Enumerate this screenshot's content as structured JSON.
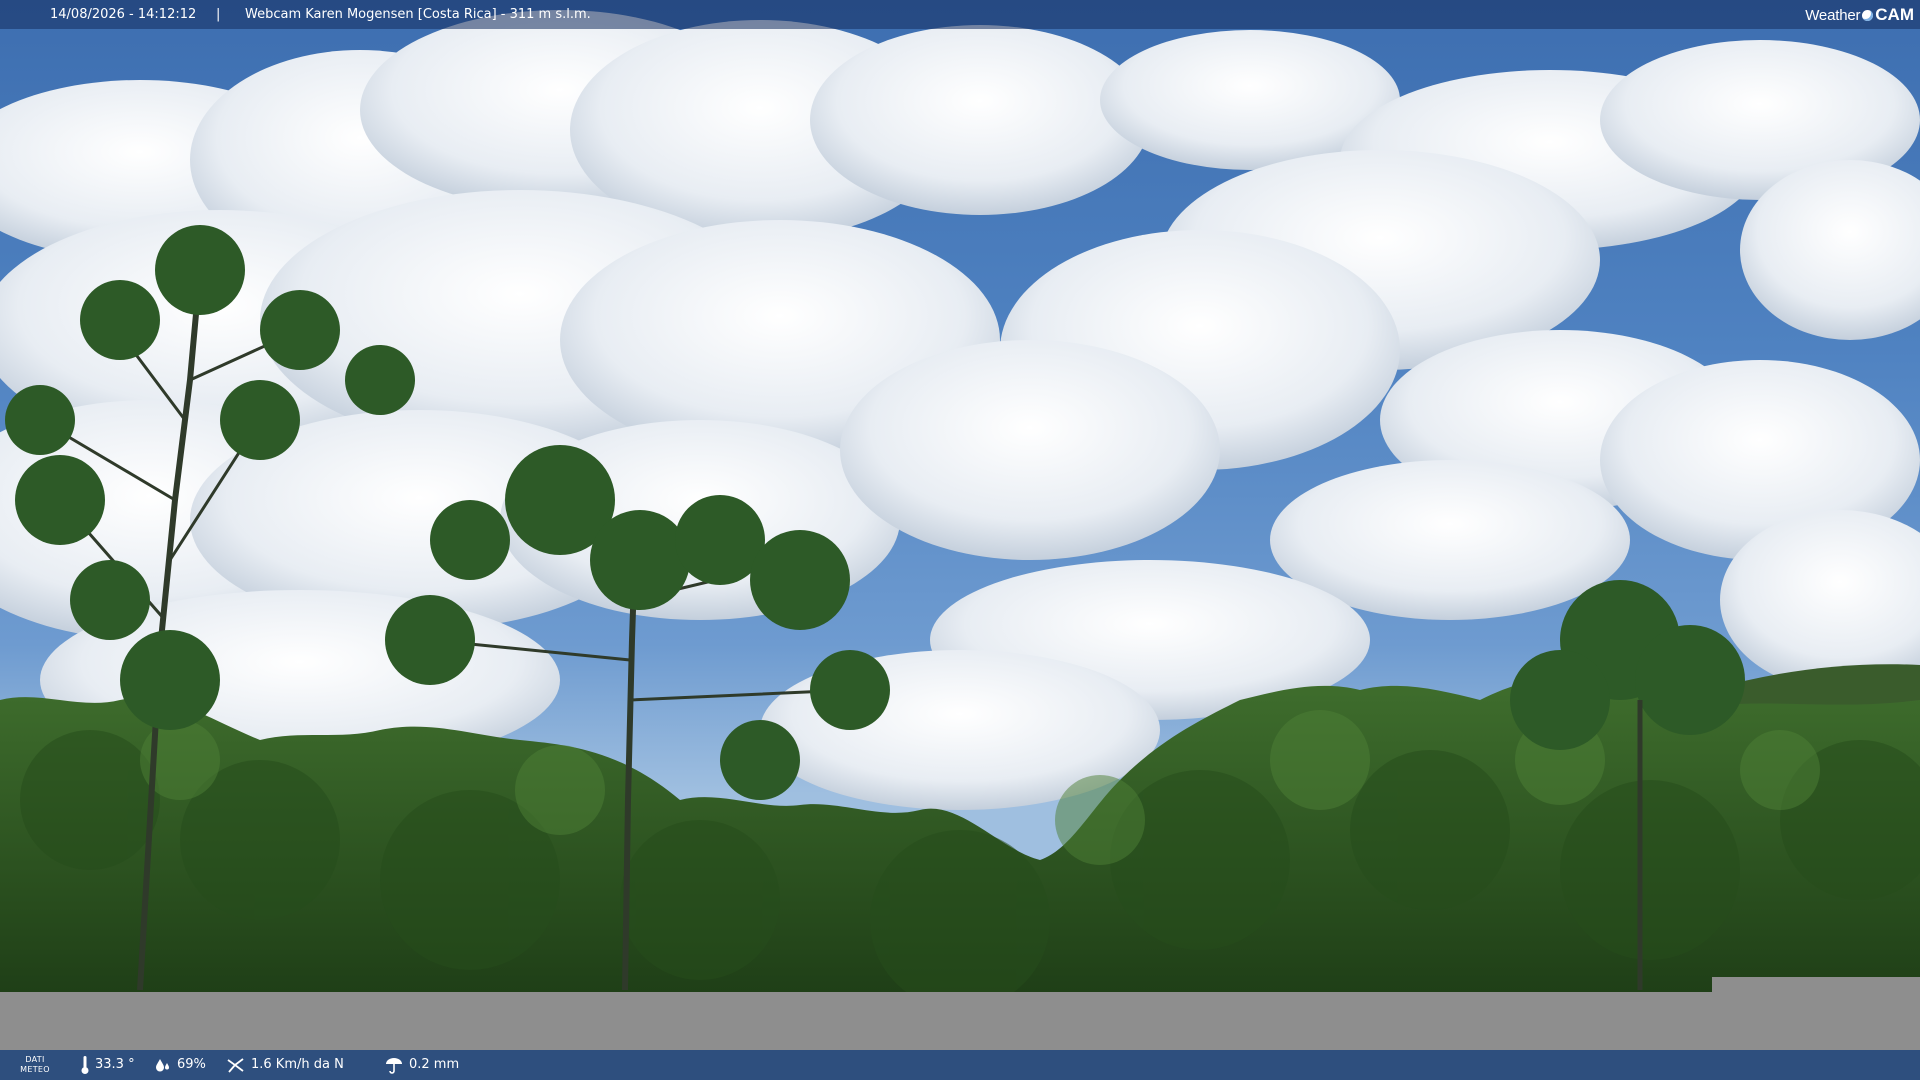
{
  "header": {
    "datetime": "14/08/2026 - 14:12:12",
    "separator": "|",
    "webcam_title": "Webcam Karen Mogensen [Costa Rica] - 311 m s.l.m.",
    "logo_prefix": "Weather",
    "logo_suffix": "CAM"
  },
  "scene": {
    "icon": "webcam-landscape-image",
    "sky_color": "#4f82c1",
    "cloud_color": "#f2f4f7",
    "forest_color": "#2f5a24"
  },
  "weather_bar": {
    "label_line1": "DATI",
    "label_line2": "METEO",
    "temperature": "33.3 °",
    "humidity": "69%",
    "wind": "1.6 Km/h da N",
    "rain": "0.2 mm",
    "icons": [
      "thermometer-icon",
      "humidity-icon",
      "wind-icon",
      "rain-icon"
    ],
    "bar_color": "#2e4f7e"
  },
  "colors": {
    "band_gray": "#8e8e8e",
    "text": "#ffffff"
  }
}
